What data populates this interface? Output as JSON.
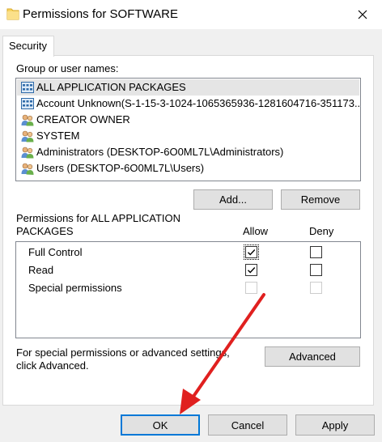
{
  "window": {
    "title": "Permissions for SOFTWARE"
  },
  "tabs": [
    {
      "label": "Security"
    }
  ],
  "group": {
    "label": "Group or user names:",
    "items": [
      {
        "label": "ALL APPLICATION PACKAGES",
        "icon": "app-package-icon",
        "selected": true
      },
      {
        "label": "Account Unknown(S-1-15-3-1024-1065365936-1281604716-351173...",
        "icon": "app-package-icon",
        "selected": false
      },
      {
        "label": "CREATOR OWNER",
        "icon": "users-group-icon",
        "selected": false
      },
      {
        "label": "SYSTEM",
        "icon": "users-group-icon",
        "selected": false
      },
      {
        "label": "Administrators (DESKTOP-6O0ML7L\\Administrators)",
        "icon": "users-group-icon",
        "selected": false
      },
      {
        "label": "Users (DESKTOP-6O0ML7L\\Users)",
        "icon": "users-group-icon",
        "selected": false
      }
    ],
    "add_label": "Add...",
    "remove_label": "Remove"
  },
  "permissions": {
    "heading_line1": "Permissions for ALL APPLICATION",
    "heading_line2": "PACKAGES",
    "allow_label": "Allow",
    "deny_label": "Deny",
    "rows": [
      {
        "label": "Full Control",
        "allow": true,
        "deny": false,
        "enabled": true
      },
      {
        "label": "Read",
        "allow": true,
        "deny": false,
        "enabled": true
      },
      {
        "label": "Special permissions",
        "allow": false,
        "deny": false,
        "enabled": false
      }
    ]
  },
  "advanced": {
    "text_line1": "For special permissions or advanced settings,",
    "text_line2": "click Advanced.",
    "button_label": "Advanced"
  },
  "footer": {
    "ok_label": "OK",
    "cancel_label": "Cancel",
    "apply_label": "Apply"
  },
  "colors": {
    "accent": "#0078d7",
    "annotation_arrow": "#e0201f",
    "folder": "#f7d562"
  }
}
